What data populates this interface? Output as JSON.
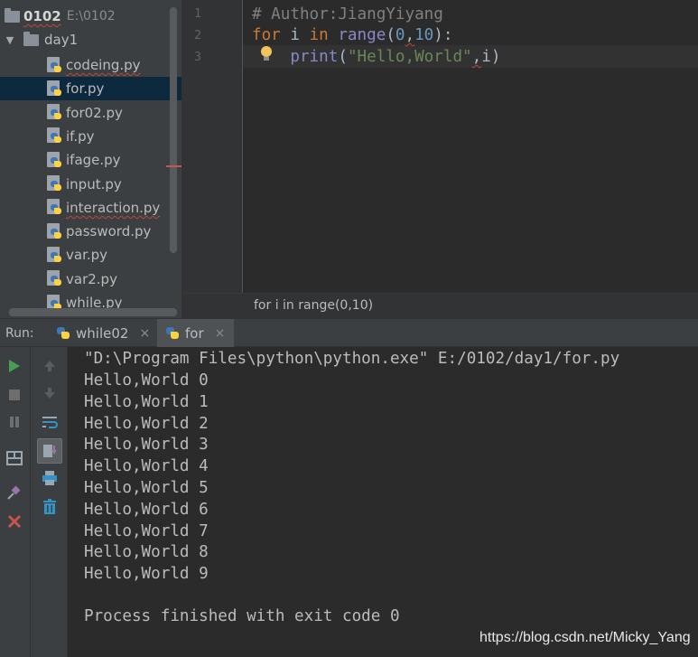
{
  "project": {
    "root_name": "0102",
    "root_path": "E:\\0102",
    "folder": "day1",
    "files": [
      {
        "name": "codeing.py",
        "selected": false
      },
      {
        "name": "for.py",
        "selected": true
      },
      {
        "name": "for02.py",
        "selected": false
      },
      {
        "name": "if.py",
        "selected": false
      },
      {
        "name": "ifage.py",
        "selected": false
      },
      {
        "name": "input.py",
        "selected": false
      },
      {
        "name": "interaction.py",
        "selected": false
      },
      {
        "name": "password.py",
        "selected": false
      },
      {
        "name": "var.py",
        "selected": false
      },
      {
        "name": "var2.py",
        "selected": false
      },
      {
        "name": "while.py",
        "selected": false
      }
    ]
  },
  "editor": {
    "line_numbers": [
      "1",
      "2",
      "3"
    ],
    "code": {
      "comment": "# Author:JiangYiyang",
      "l2_for": "for",
      "l2_var": " i ",
      "l2_in": "in",
      "l2_sp": " ",
      "l2_range": "range",
      "l2_open": "(",
      "l2_n1": "0",
      "l2_comma": ",",
      "l2_n2": "10",
      "l2_close": "):",
      "l3_indent": "    ",
      "l3_print": "print",
      "l3_open": "(",
      "l3_str": "\"Hello,World\"",
      "l3_comma": ",",
      "l3_var": "i",
      "l3_close": ")"
    },
    "breadcrumb": "for i in range(0,10)"
  },
  "run": {
    "label": "Run:",
    "tabs": [
      {
        "label": "while02",
        "active": false
      },
      {
        "label": "for",
        "active": true
      }
    ],
    "close_glyph": "×"
  },
  "tools": {
    "left": [
      "run-icon",
      "stop-icon",
      "pause-icon",
      "layout-icon",
      "pin-icon",
      "close-icon"
    ],
    "mid": [
      "up-arrow-icon",
      "down-arrow-icon",
      "soft-wrap-icon",
      "scroll-to-end-icon",
      "print-icon",
      "trash-icon"
    ]
  },
  "console": {
    "command": "\"D:\\Program Files\\python\\python.exe\" E:/0102/day1/for.py",
    "lines": [
      "Hello,World 0",
      "Hello,World 1",
      "Hello,World 2",
      "Hello,World 3",
      "Hello,World 4",
      "Hello,World 5",
      "Hello,World 6",
      "Hello,World 7",
      "Hello,World 8",
      "Hello,World 9"
    ],
    "exit": "Process finished with exit code 0"
  },
  "watermark": "https://blog.csdn.net/Micky_Yang",
  "colors": {
    "keyword": "#cc7832",
    "number": "#6897bb",
    "string": "#6a8759",
    "comment": "#808080",
    "selection": "#0d293e",
    "run_green": "#499c54",
    "stop_red": "#c75450"
  }
}
